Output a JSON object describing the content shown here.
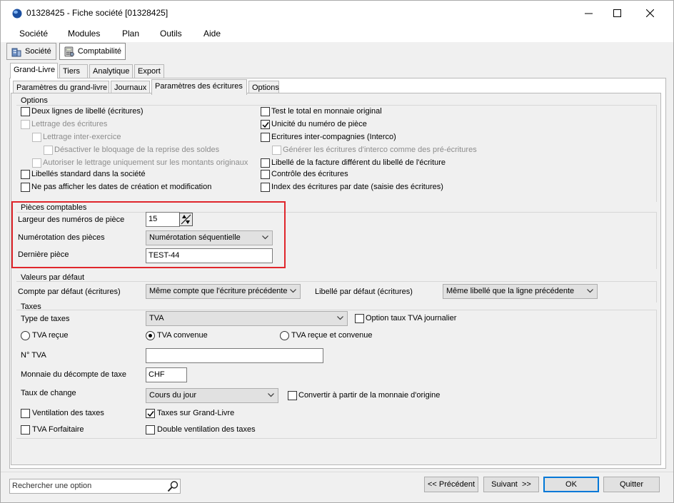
{
  "window": {
    "title": "01328425 - Fiche société [01328425]",
    "controls": [
      "minimize",
      "maximize",
      "close"
    ]
  },
  "menu": [
    "Société",
    "Modules",
    "Plan",
    "Outils",
    "Aide"
  ],
  "modules": [
    {
      "label": "Société",
      "icon": "building-icon",
      "active": false
    },
    {
      "label": "Comptabilité",
      "icon": "calculator-icon",
      "active": true
    }
  ],
  "tabs_level1": [
    {
      "label": "Grand-Livre",
      "selected": true
    },
    {
      "label": "Tiers",
      "selected": false
    },
    {
      "label": "Analytique",
      "selected": false
    },
    {
      "label": "Export",
      "selected": false
    }
  ],
  "tabs_level2": [
    {
      "label": "Paramètres du grand-livre",
      "selected": false
    },
    {
      "label": "Journaux",
      "selected": false
    },
    {
      "label": "Paramètres des écritures",
      "selected": true
    },
    {
      "label": "Options",
      "selected": false
    }
  ],
  "options": {
    "title": "Options",
    "left": [
      {
        "label": "Deux lignes de libellé (écritures)",
        "checked": false,
        "disabled": false
      },
      {
        "label": "Lettrage des écritures",
        "checked": false,
        "disabled": true
      },
      {
        "label": "Lettrage inter-exercice",
        "checked": false,
        "disabled": true
      },
      {
        "label": "Désactiver le bloquage de la reprise des soldes",
        "checked": false,
        "disabled": true
      },
      {
        "label": "Autoriser le lettrage uniquement sur les montants originaux",
        "checked": false,
        "disabled": true
      },
      {
        "label": "Libellés standard dans la société",
        "checked": false,
        "disabled": false
      },
      {
        "label": "Ne pas afficher les dates de création et modification",
        "checked": false,
        "disabled": false
      }
    ],
    "right": [
      {
        "label": "Test le total en monnaie original",
        "checked": false,
        "disabled": false
      },
      {
        "label": "Unicité du numéro de pièce",
        "checked": true,
        "disabled": false
      },
      {
        "label": "Ecritures inter-compagnies (Interco)",
        "checked": false,
        "disabled": false
      },
      {
        "label": "Générer les écritures d'interco comme des pré-écritures",
        "checked": false,
        "disabled": true
      },
      {
        "label": "Libellé de la facture différent du libellé de l'écriture",
        "checked": false,
        "disabled": false
      },
      {
        "label": "Contrôle des écritures",
        "checked": false,
        "disabled": false
      },
      {
        "label": "Index des écritures par date (saisie des écritures)",
        "checked": false,
        "disabled": false
      }
    ]
  },
  "pieces": {
    "title": "Pièces comptables",
    "width_label": "Largeur des numéros de pièce",
    "width_value": "15",
    "numbering_label": "Numérotation des pièces",
    "numbering_value": "Numérotation séquentielle",
    "last_label": "Dernière pièce",
    "last_value": "TEST-44",
    "highlight_color": "#e0262c"
  },
  "defaults": {
    "title": "Valeurs par défaut",
    "account_label": "Compte par défaut (écritures)",
    "account_value": "Même compte que l'écriture précédente",
    "label_label": "Libellé par défaut (écritures)",
    "label_value": "Même libellé que la ligne précédente"
  },
  "taxes": {
    "title": "Taxes",
    "type_label": "Type de taxes",
    "type_value": "TVA",
    "daily_rate_label": "Option taux TVA journalier",
    "daily_rate_checked": false,
    "radios": [
      {
        "label": "TVA reçue",
        "selected": false
      },
      {
        "label": "TVA convenue",
        "selected": true
      },
      {
        "label": "TVA reçue et convenue",
        "selected": false
      }
    ],
    "vat_no_label": "N° TVA",
    "vat_no_value": "",
    "currency_label": "Monnaie du décompte de taxe",
    "currency_value": "CHF",
    "rate_label": "Taux de change",
    "rate_value": "Cours du jour",
    "convert_label": "Convertir à partir de la monnaie d'origine",
    "convert_checked": false,
    "ventilation_label": "Ventilation des taxes",
    "ventilation_checked": false,
    "ledger_label": "Taxes sur Grand-Livre",
    "ledger_checked": true,
    "flat_label": "TVA Forfaitaire",
    "flat_checked": false,
    "double_label": "Double ventilation des taxes",
    "double_checked": false
  },
  "footer": {
    "search_placeholder": "Rechercher une option",
    "prev": "<< Précédent",
    "next": "Suivant  >>",
    "ok": "OK",
    "quit": "Quitter",
    "accent": "#0078d7"
  }
}
